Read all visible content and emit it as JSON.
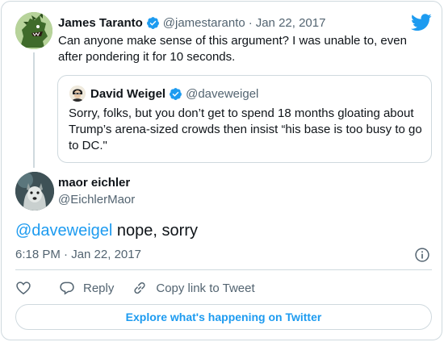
{
  "colors": {
    "accent": "#1d9bf0",
    "text_primary": "#0f1419",
    "text_secondary": "#536471",
    "border": "#cfd9de"
  },
  "parent_tweet": {
    "author_name": "James Taranto",
    "author_handle": "@jamestaranto",
    "separator": "·",
    "date": "Jan 22, 2017",
    "text": "Can anyone make sense of this argument? I was unable to, even after pondering it for 10 seconds.",
    "avatar_icon": "godzilla-avatar",
    "verified_icon": "verified-badge-icon"
  },
  "quoted_tweet": {
    "author_name": "David Weigel",
    "author_handle": "@daveweigel",
    "text": "Sorry, folks, but you don’t get to spend 18 months gloating about Trump’s arena-sized crowds then insist “his base is too busy to go to DC.\"",
    "avatar_icon": "person-avatar",
    "verified_icon": "verified-badge-icon"
  },
  "main_tweet": {
    "author_name": "maor eichler",
    "author_handle": "@EichlerMaor",
    "mention": "@daveweigel",
    "text": " nope, sorry",
    "timestamp": "6:18 PM · Jan 22, 2017",
    "avatar_icon": "dog-avatar"
  },
  "actions": {
    "like_icon": "heart-icon",
    "reply_label": "Reply",
    "reply_icon": "reply-icon",
    "copy_link_label": "Copy link to Tweet",
    "copy_link_icon": "link-icon"
  },
  "explore_button": {
    "label": "Explore what's happening on Twitter"
  },
  "brand_icon": "twitter-bird-icon",
  "info_icon": "info-icon"
}
